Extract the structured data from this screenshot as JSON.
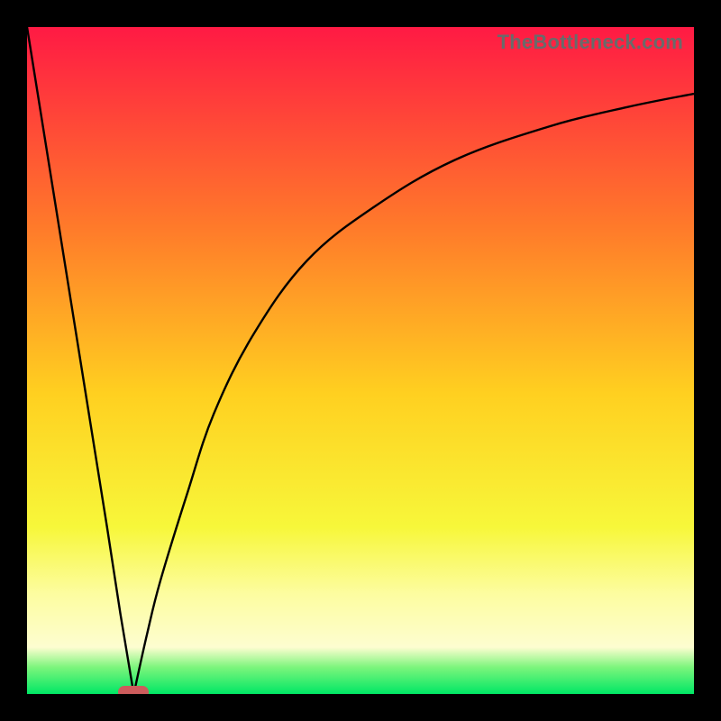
{
  "watermark": "TheBottleneck.com",
  "colors": {
    "top": "#ff1a44",
    "upper_mid": "#ff7a2a",
    "mid": "#ffd020",
    "lower_mid": "#f7f73a",
    "pale": "#fdfda0",
    "green_light": "#7cf57c",
    "green": "#00e765",
    "marker": "#cd5c5c",
    "curve": "#000000",
    "frame": "#000000"
  },
  "chart_data": {
    "type": "line",
    "title": "",
    "xlabel": "",
    "ylabel": "",
    "xlim": [
      0,
      100
    ],
    "ylim": [
      0,
      100
    ],
    "note": "V-shaped bottleneck curve, minimum near x≈16; left branch descends nearly linearly from top-left, right branch rises concavely approaching y≈90 at right edge",
    "series": [
      {
        "name": "left-branch",
        "x": [
          0,
          4,
          8,
          12,
          14,
          16
        ],
        "values": [
          100,
          75,
          50,
          25,
          12,
          0
        ]
      },
      {
        "name": "right-branch",
        "x": [
          16,
          18,
          20,
          24,
          28,
          34,
          42,
          52,
          64,
          78,
          90,
          100
        ],
        "values": [
          0,
          9,
          17,
          30,
          42,
          54,
          65,
          73,
          80,
          85,
          88,
          90
        ]
      }
    ],
    "marker": {
      "x": 16,
      "y": 0
    },
    "background_gradient_stops": [
      {
        "pct": 0,
        "color": "#ff1a44"
      },
      {
        "pct": 30,
        "color": "#ff7a2a"
      },
      {
        "pct": 55,
        "color": "#ffd020"
      },
      {
        "pct": 75,
        "color": "#f7f73a"
      },
      {
        "pct": 85,
        "color": "#fdfda0"
      },
      {
        "pct": 93,
        "color": "#fdfdd0"
      },
      {
        "pct": 96,
        "color": "#7cf57c"
      },
      {
        "pct": 100,
        "color": "#00e765"
      }
    ]
  }
}
